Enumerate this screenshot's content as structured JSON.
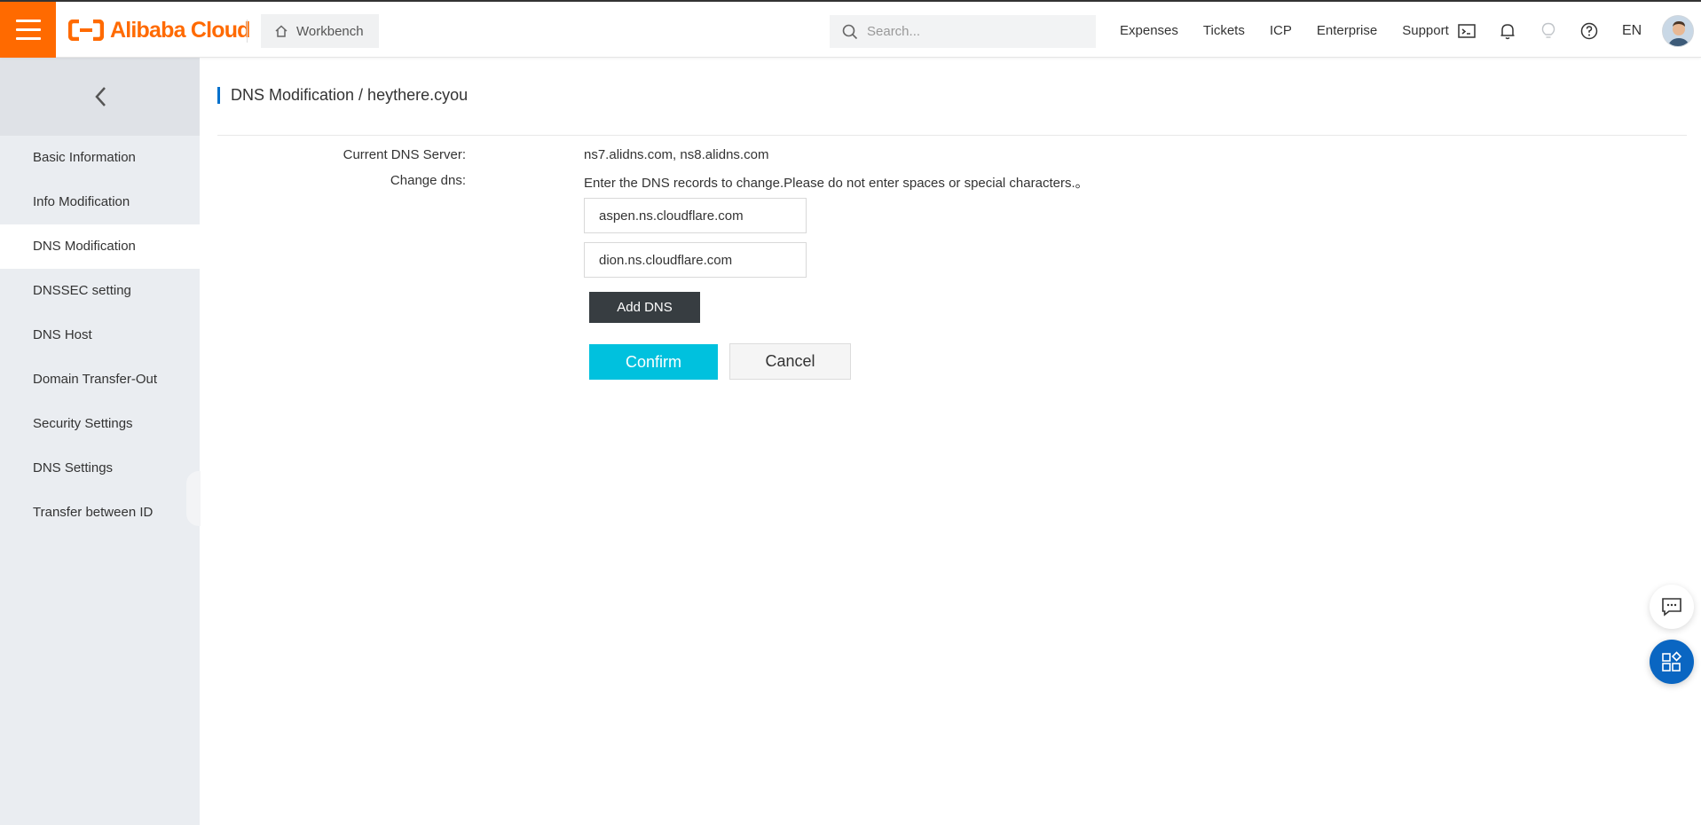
{
  "colors": {
    "brand": "#ff6a00",
    "primary_button": "#00c1de",
    "dark_button": "#373d41",
    "title_accent": "#0070cc",
    "float_button": "#0a66c2"
  },
  "header": {
    "logo_text": "Alibaba Cloud",
    "workbench_label": "Workbench",
    "search_placeholder": "Search...",
    "links": [
      "Expenses",
      "Tickets",
      "ICP",
      "Enterprise",
      "Support"
    ],
    "icons": [
      "terminal-icon",
      "bell-icon",
      "lightbulb-icon",
      "help-icon"
    ],
    "language": "EN"
  },
  "sidebar": {
    "items": [
      {
        "label": "Basic Information"
      },
      {
        "label": "Info Modification"
      },
      {
        "label": "DNS Modification",
        "active": true
      },
      {
        "label": "DNSSEC setting"
      },
      {
        "label": "DNS Host"
      },
      {
        "label": "Domain Transfer-Out"
      },
      {
        "label": "Security Settings"
      },
      {
        "label": "DNS Settings"
      },
      {
        "label": "Transfer between ID"
      }
    ]
  },
  "main": {
    "title": "DNS Modification / heythere.cyou",
    "current_dns_label": "Current DNS Server:",
    "current_dns_value": "ns7.alidns.com, ns8.alidns.com",
    "change_dns_label": "Change dns:",
    "change_dns_hint": "Enter the DNS records to change.Please do not enter spaces or special characters.。",
    "dns_inputs": [
      "aspen.ns.cloudflare.com",
      "dion.ns.cloudflare.com"
    ],
    "add_dns_label": "Add DNS",
    "confirm_label": "Confirm",
    "cancel_label": "Cancel"
  }
}
